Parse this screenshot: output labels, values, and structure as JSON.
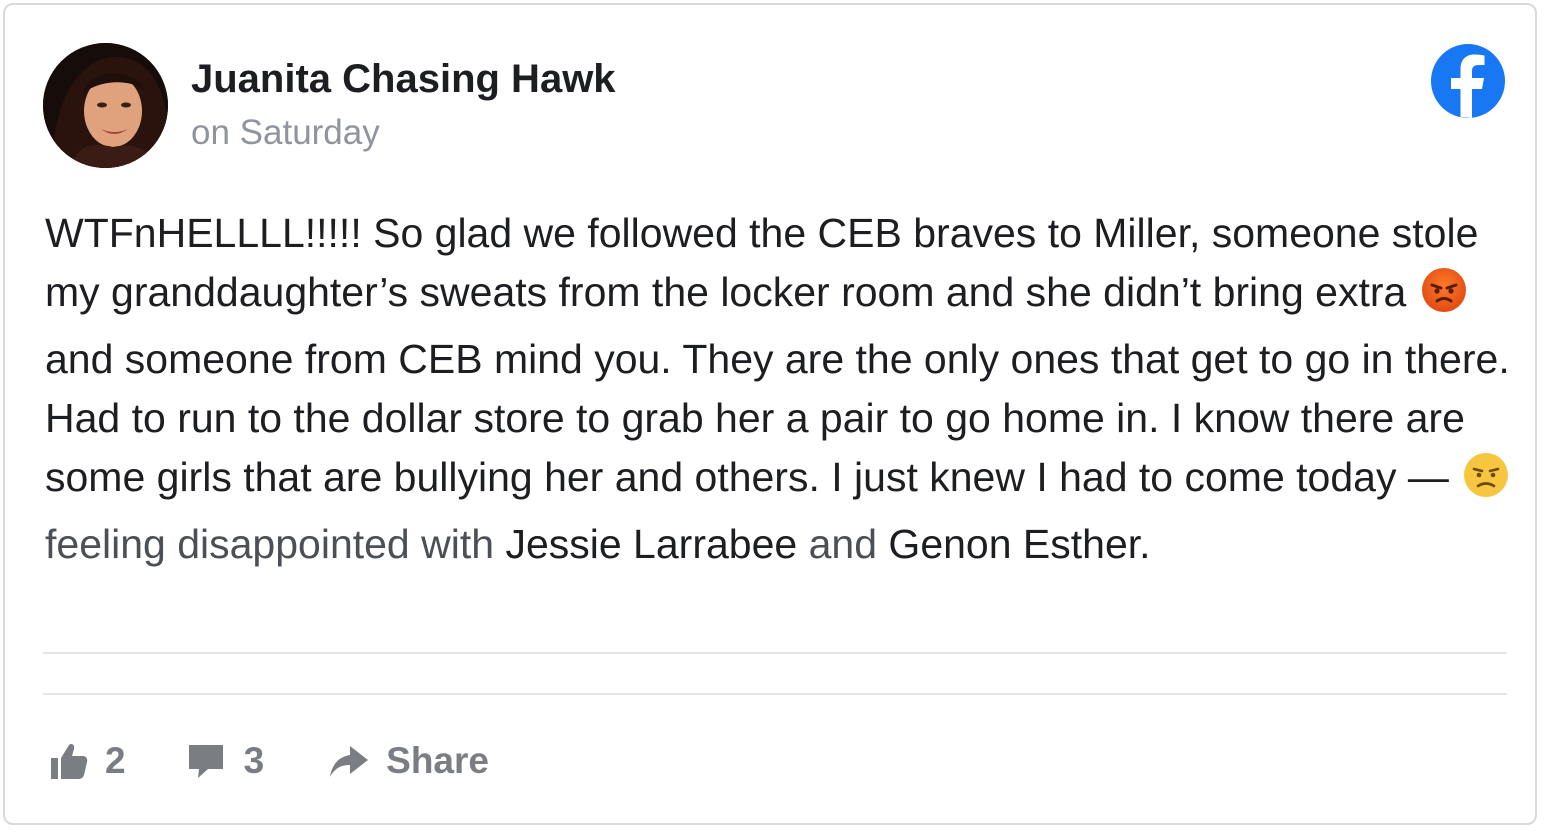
{
  "post": {
    "author": "Juanita Chasing Hawk",
    "time": "on Saturday",
    "text_1": "WTFnHELLLL!!!!! So glad we followed the CEB braves to Miller, someone stole my granddaughter’s sweats from the locker room and she didn’t bring extra",
    "emoji_1": "angry-face",
    "text_2": "and someone from CEB mind you. They are the only ones that get to go in there. Had to run to the dollar store to grab her a pair to go home in. I know there are some girls that are bullying her and others. I just knew I had to come today —",
    "emoji_2": "disappointed-face",
    "feeling": "feeling disappointed with",
    "tag_1": "Jessie Larrabee",
    "and": "and",
    "tag_2": "Genon Esther",
    "end_punct": "."
  },
  "actions": {
    "like_icon": "thumbs-up-icon",
    "like_count": "2",
    "comment_icon": "comment-icon",
    "comment_count": "3",
    "share_icon": "share-arrow-icon",
    "share_label": "Share"
  },
  "brand": {
    "logo": "facebook-logo-icon",
    "color": "#1877f2"
  }
}
